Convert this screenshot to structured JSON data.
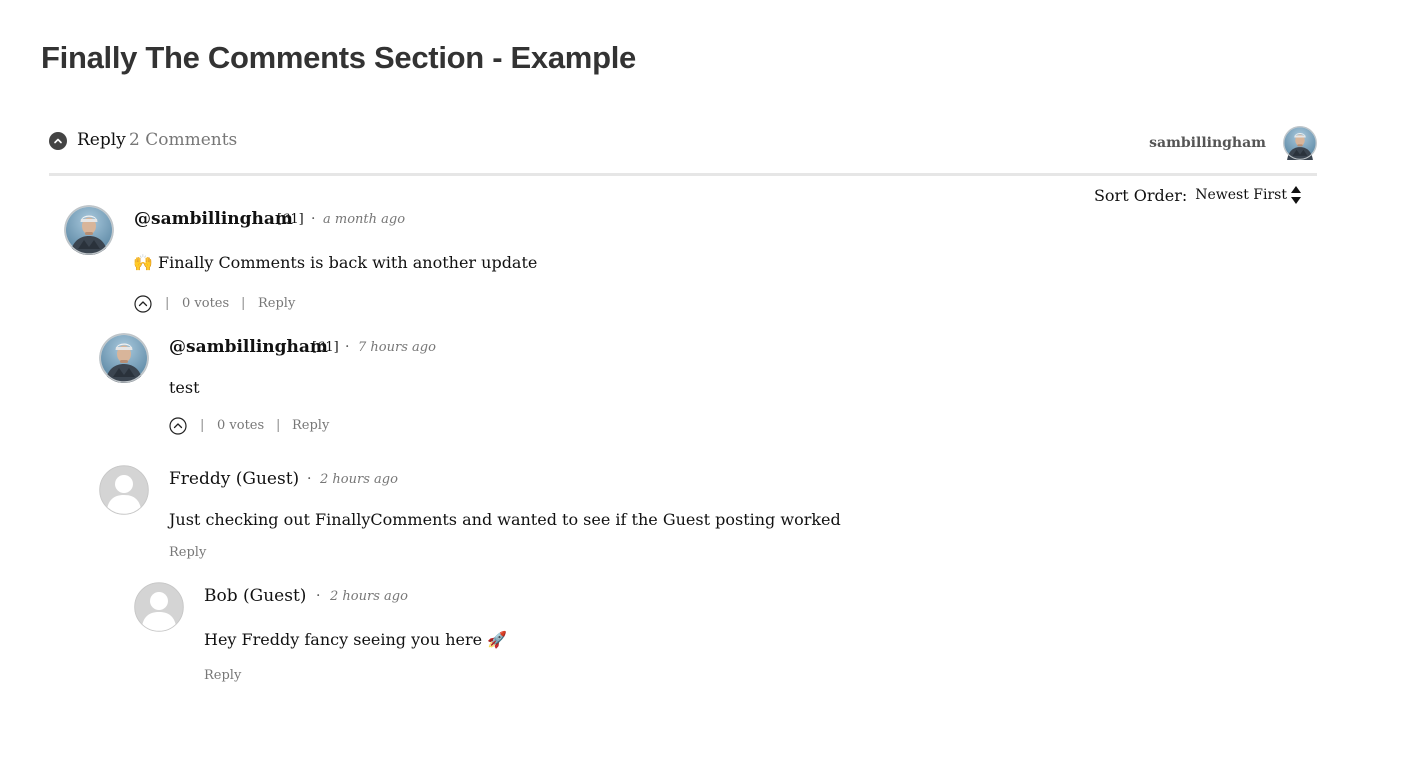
{
  "page": {
    "title": "Finally The Comments Section - Example"
  },
  "header": {
    "reply_label": "Reply",
    "comment_count": "2 Comments",
    "current_user": "sambillingham"
  },
  "sort": {
    "label": "Sort Order:",
    "value": "Newest First"
  },
  "comments": [
    {
      "author": "@sambillingham",
      "rank": "[61]",
      "time": "a month ago",
      "emoji": "🙌",
      "text": "Finally Comments is back with another update",
      "votes": "0 votes",
      "reply": "Reply"
    },
    {
      "author": "@sambillingham",
      "rank": "[61]",
      "time": "7 hours ago",
      "text": "test",
      "votes": "0 votes",
      "reply": "Reply"
    },
    {
      "author": "Freddy (Guest)",
      "time": "2 hours ago",
      "text": "Just checking out FinallyComments and wanted to see if the Guest posting worked",
      "reply": "Reply"
    },
    {
      "author": "Bob (Guest)",
      "time": "2 hours ago",
      "text": "Hey Freddy fancy seeing you here",
      "emoji": "🚀",
      "reply": "Reply"
    }
  ],
  "separators": {
    "dot": "·",
    "pipe": "|"
  },
  "colors": {
    "accent": "#444444",
    "divider": "#e6e6e6",
    "muted": "#777777"
  },
  "icons": [
    "chevron-up-circle-icon",
    "upvote-icon",
    "sort-arrows-icon",
    "user-avatar",
    "guest-avatar"
  ]
}
